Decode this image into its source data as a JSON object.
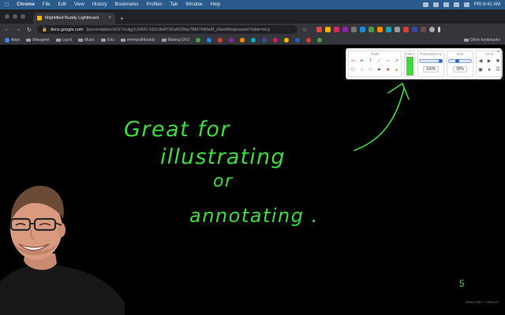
{
  "menubar": {
    "items": [
      "Chrome",
      "File",
      "Edit",
      "View",
      "History",
      "Bookmarks",
      "Profiles",
      "Tab",
      "Window",
      "Help"
    ],
    "clock": "FRI 6:41 AM"
  },
  "tab": {
    "title": "Mightified Buddy Lightboard",
    "close": "×"
  },
  "newtab": "+",
  "address": {
    "domain": "docs.google.com",
    "path": "/presentation/d/1F7euijgVJvWG-Sb2c8xRTtXw6O9ep7BM7htMeM_t3am/Ma/present?slide=id.p"
  },
  "bookmarks": {
    "items": [
      "Apps",
      "Misogeist",
      "Layrd",
      "Music",
      "Edu",
      "emimpathbuddy",
      "Making EFU"
    ],
    "other": "Other bookmarks"
  },
  "toolpanel": {
    "tools_label": "Tools",
    "color_label": "Color",
    "transparency_label": "Transparency",
    "transparency_value": "100%",
    "size_label": "Size",
    "size_value": "30%",
    "goto_label": "Go to",
    "close": "×"
  },
  "annotation": {
    "line1": "Great for",
    "line2": "illustrating",
    "line3": "or",
    "line4": "annotating ."
  },
  "slide_number": "5",
  "footer_mark": "WEBITHEL TONIGHT",
  "colors": {
    "ink": "#3cdc3c",
    "menubar": "#2b5a8c"
  }
}
